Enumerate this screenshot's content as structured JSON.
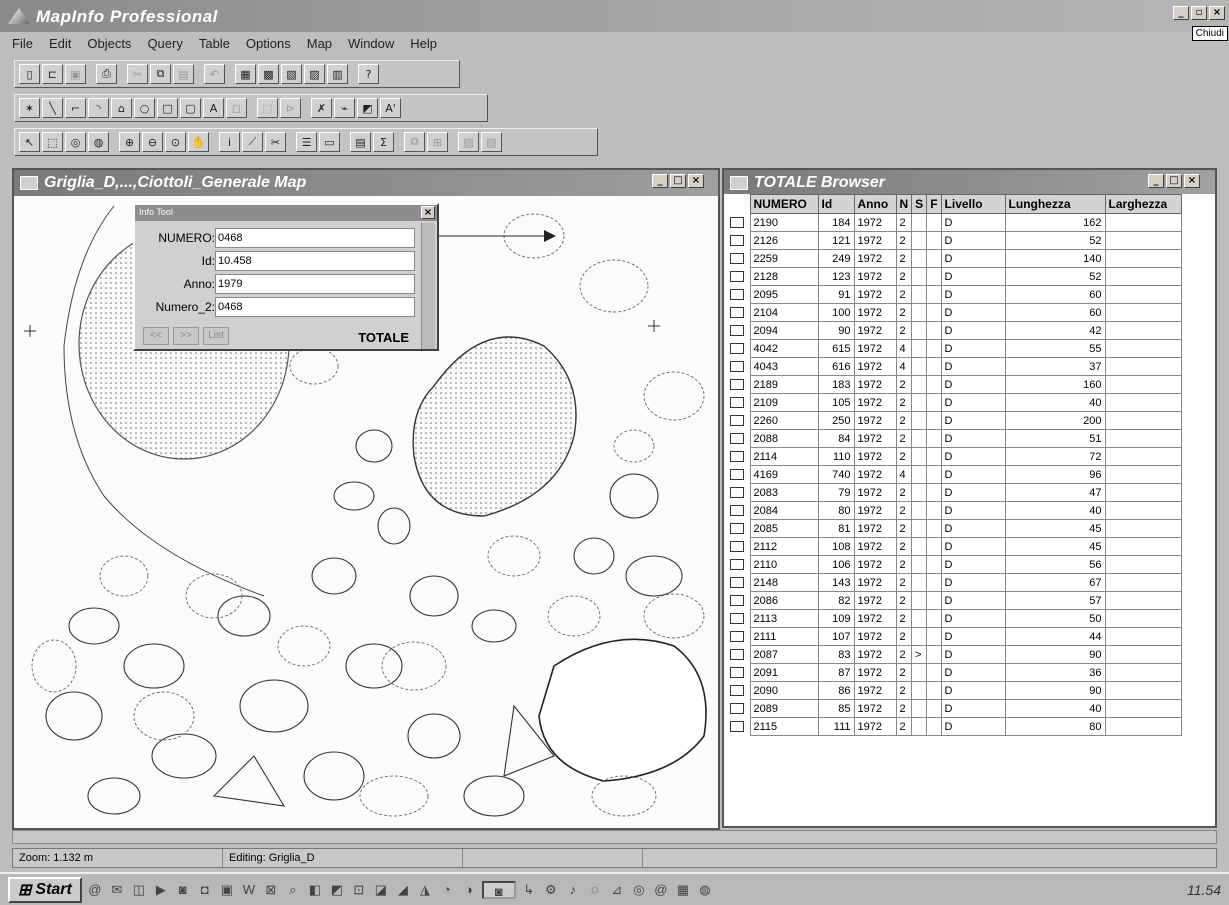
{
  "app": {
    "title": "MapInfo Professional",
    "close_tooltip": "Chiudi"
  },
  "menu": [
    "File",
    "Edit",
    "Objects",
    "Query",
    "Table",
    "Options",
    "Map",
    "Window",
    "Help"
  ],
  "map_window": {
    "title": "Griglia_D,...,Ciottoli_Generale Map"
  },
  "info_tool": {
    "title": "Info Tool",
    "fields": [
      {
        "label": "NUMERO:",
        "value": "0468"
      },
      {
        "label": "Id:",
        "value": "10.458"
      },
      {
        "label": "Anno:",
        "value": "1979"
      },
      {
        "label": "Numero_2:",
        "value": "0468"
      }
    ],
    "buttons": [
      "<<",
      ">>",
      "List"
    ],
    "table_name": "TOTALE"
  },
  "browser": {
    "title": "TOTALE Browser",
    "columns": [
      "NUMERO",
      "Id",
      "Anno",
      "N",
      "S",
      "F",
      "Livello",
      "Lunghezza",
      "Larghezza"
    ],
    "rows": [
      [
        "2190",
        "184",
        "1972",
        "2",
        "",
        "",
        "D",
        "162"
      ],
      [
        "2126",
        "121",
        "1972",
        "2",
        "",
        "",
        "D",
        "52"
      ],
      [
        "2259",
        "249",
        "1972",
        "2",
        "",
        "",
        "D",
        "140"
      ],
      [
        "2128",
        "123",
        "1972",
        "2",
        "",
        "",
        "D",
        "52"
      ],
      [
        "2095",
        "91",
        "1972",
        "2",
        "",
        "",
        "D",
        "60"
      ],
      [
        "2104",
        "100",
        "1972",
        "2",
        "",
        "",
        "D",
        "60"
      ],
      [
        "2094",
        "90",
        "1972",
        "2",
        "",
        "",
        "D",
        "42"
      ],
      [
        "4042",
        "615",
        "1972",
        "4",
        "",
        "",
        "D",
        "55"
      ],
      [
        "4043",
        "616",
        "1972",
        "4",
        "",
        "",
        "D",
        "37"
      ],
      [
        "2189",
        "183",
        "1972",
        "2",
        "",
        "",
        "D",
        "160"
      ],
      [
        "2109",
        "105",
        "1972",
        "2",
        "",
        "",
        "D",
        "40"
      ],
      [
        "2260",
        "250",
        "1972",
        "2",
        "",
        "",
        "D",
        "200"
      ],
      [
        "2088",
        "84",
        "1972",
        "2",
        "",
        "",
        "D",
        "51"
      ],
      [
        "2114",
        "110",
        "1972",
        "2",
        "",
        "",
        "D",
        "72"
      ],
      [
        "4169",
        "740",
        "1972",
        "4",
        "",
        "",
        "D",
        "96"
      ],
      [
        "2083",
        "79",
        "1972",
        "2",
        "",
        "",
        "D",
        "47"
      ],
      [
        "2084",
        "80",
        "1972",
        "2",
        "",
        "",
        "D",
        "40"
      ],
      [
        "2085",
        "81",
        "1972",
        "2",
        "",
        "",
        "D",
        "45"
      ],
      [
        "2112",
        "108",
        "1972",
        "2",
        "",
        "",
        "D",
        "45"
      ],
      [
        "2110",
        "106",
        "1972",
        "2",
        "",
        "",
        "D",
        "56"
      ],
      [
        "2148",
        "143",
        "1972",
        "2",
        "",
        "",
        "D",
        "67"
      ],
      [
        "2086",
        "82",
        "1972",
        "2",
        "",
        "",
        "D",
        "57"
      ],
      [
        "2113",
        "109",
        "1972",
        "2",
        "",
        "",
        "D",
        "50"
      ],
      [
        "2111",
        "107",
        "1972",
        "2",
        "",
        "",
        "D",
        "44"
      ],
      [
        "2087",
        "83",
        "1972",
        "2",
        ">",
        "",
        "D",
        "90"
      ],
      [
        "2091",
        "87",
        "1972",
        "2",
        "",
        "",
        "D",
        "36"
      ],
      [
        "2090",
        "86",
        "1972",
        "2",
        "",
        "",
        "D",
        "90"
      ],
      [
        "2089",
        "85",
        "1972",
        "2",
        "",
        "",
        "D",
        "40"
      ],
      [
        "2115",
        "111",
        "1972",
        "2",
        "",
        "",
        "D",
        "80"
      ]
    ]
  },
  "status": {
    "zoom": "Zoom: 1.132 m",
    "editing": "Editing: Griglia_D"
  },
  "taskbar": {
    "start": "Start",
    "clock": "11.54"
  }
}
